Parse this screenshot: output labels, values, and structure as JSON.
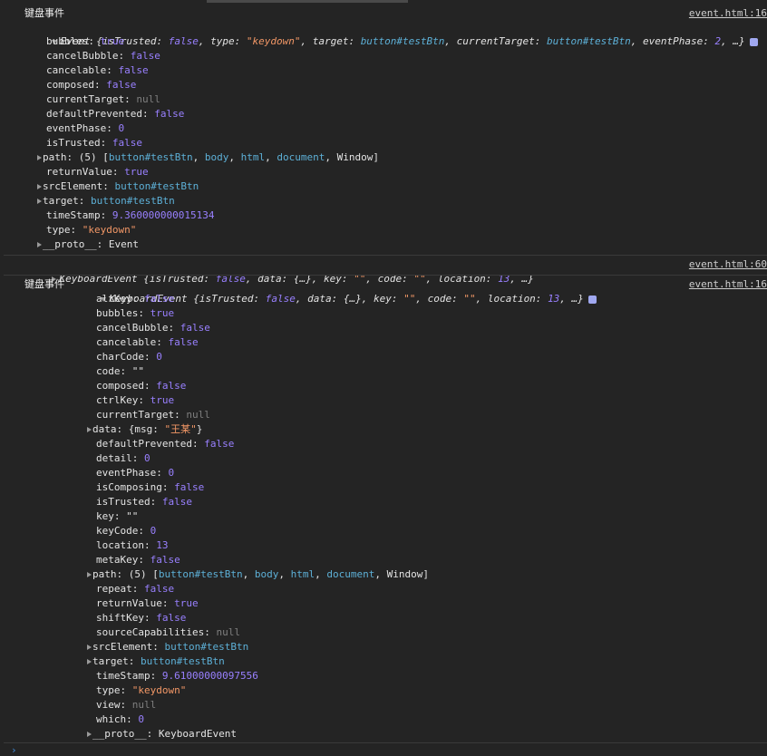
{
  "top": {
    "label": "键盘事件",
    "source": "event.html:16",
    "summary": {
      "lead": "Event {",
      "items": [
        {
          "k": "isTrusted",
          "v": "false",
          "t": "bool"
        },
        {
          "k": "type",
          "v": "\"keydown\"",
          "t": "str"
        },
        {
          "k": "target",
          "v": "button#testBtn",
          "t": "ref"
        },
        {
          "k": "currentTarget",
          "v": "button#testBtn",
          "t": "ref"
        },
        {
          "k": "eventPhase",
          "v": "2",
          "t": "num"
        }
      ],
      "tail": ", …}"
    },
    "props": [
      {
        "k": "bubbles",
        "v": "true",
        "t": "bool"
      },
      {
        "k": "cancelBubble",
        "v": "false",
        "t": "bool"
      },
      {
        "k": "cancelable",
        "v": "false",
        "t": "bool"
      },
      {
        "k": "composed",
        "v": "false",
        "t": "bool"
      },
      {
        "k": "currentTarget",
        "v": "null",
        "t": "null"
      },
      {
        "k": "defaultPrevented",
        "v": "false",
        "t": "bool"
      },
      {
        "k": "eventPhase",
        "v": "0",
        "t": "num"
      },
      {
        "k": "isTrusted",
        "v": "false",
        "t": "bool"
      },
      {
        "k": "path",
        "v": "(5) [button#testBtn, body, html, document, Window]",
        "t": "plain",
        "exp": true
      },
      {
        "k": "returnValue",
        "v": "true",
        "t": "bool"
      },
      {
        "k": "srcElement",
        "v": "button#testBtn",
        "t": "ref",
        "exp": true
      },
      {
        "k": "target",
        "v": "button#testBtn",
        "t": "ref",
        "exp": true
      },
      {
        "k": "timeStamp",
        "v": "9.360000000015134",
        "t": "num"
      },
      {
        "k": "type",
        "v": "\"keydown\"",
        "t": "str"
      },
      {
        "k": "__proto__",
        "v": "Event",
        "t": "plain",
        "exp": true
      }
    ]
  },
  "middle": {
    "source": "event.html:60",
    "summary": {
      "lead": "KeyboardEvent {",
      "items": [
        {
          "k": "isTrusted",
          "v": "false",
          "t": "bool"
        },
        {
          "k": "data",
          "v": "{…}",
          "t": "plain"
        },
        {
          "k": "key",
          "v": "\"\"",
          "t": "str"
        },
        {
          "k": "code",
          "v": "\"\"",
          "t": "str"
        },
        {
          "k": "location",
          "v": "13",
          "t": "num"
        }
      ],
      "tail": ", …}"
    }
  },
  "bottom": {
    "label": "键盘事件",
    "source": "event.html:16",
    "summary": {
      "lead": "KeyboardEvent {",
      "items": [
        {
          "k": "isTrusted",
          "v": "false",
          "t": "bool"
        },
        {
          "k": "data",
          "v": "{…}",
          "t": "plain"
        },
        {
          "k": "key",
          "v": "\"\"",
          "t": "str"
        },
        {
          "k": "code",
          "v": "\"\"",
          "t": "str"
        },
        {
          "k": "location",
          "v": "13",
          "t": "num"
        }
      ],
      "tail": ", …}"
    },
    "props": [
      {
        "k": "altKey",
        "v": "false",
        "t": "bool"
      },
      {
        "k": "bubbles",
        "v": "true",
        "t": "bool"
      },
      {
        "k": "cancelBubble",
        "v": "false",
        "t": "bool"
      },
      {
        "k": "cancelable",
        "v": "false",
        "t": "bool"
      },
      {
        "k": "charCode",
        "v": "0",
        "t": "num"
      },
      {
        "k": "code",
        "v": "\"\"",
        "t": "plain"
      },
      {
        "k": "composed",
        "v": "false",
        "t": "bool"
      },
      {
        "k": "ctrlKey",
        "v": "true",
        "t": "bool"
      },
      {
        "k": "currentTarget",
        "v": "null",
        "t": "null"
      },
      {
        "k": "data",
        "v": "{msg: \"王某\"}",
        "t": "data",
        "exp": true
      },
      {
        "k": "defaultPrevented",
        "v": "false",
        "t": "bool"
      },
      {
        "k": "detail",
        "v": "0",
        "t": "num"
      },
      {
        "k": "eventPhase",
        "v": "0",
        "t": "num"
      },
      {
        "k": "isComposing",
        "v": "false",
        "t": "bool"
      },
      {
        "k": "isTrusted",
        "v": "false",
        "t": "bool"
      },
      {
        "k": "key",
        "v": "\"\"",
        "t": "plain"
      },
      {
        "k": "keyCode",
        "v": "0",
        "t": "num"
      },
      {
        "k": "location",
        "v": "13",
        "t": "num"
      },
      {
        "k": "metaKey",
        "v": "false",
        "t": "bool"
      },
      {
        "k": "path",
        "v": "(5) [button#testBtn, body, html, document, Window]",
        "t": "plain",
        "exp": true
      },
      {
        "k": "repeat",
        "v": "false",
        "t": "bool"
      },
      {
        "k": "returnValue",
        "v": "true",
        "t": "bool"
      },
      {
        "k": "shiftKey",
        "v": "false",
        "t": "bool"
      },
      {
        "k": "sourceCapabilities",
        "v": "null",
        "t": "null"
      },
      {
        "k": "srcElement",
        "v": "button#testBtn",
        "t": "ref",
        "exp": true
      },
      {
        "k": "target",
        "v": "button#testBtn",
        "t": "ref",
        "exp": true
      },
      {
        "k": "timeStamp",
        "v": "9.61000000097556",
        "t": "num"
      },
      {
        "k": "type",
        "v": "\"keydown\"",
        "t": "str"
      },
      {
        "k": "view",
        "v": "null",
        "t": "null"
      },
      {
        "k": "which",
        "v": "0",
        "t": "num"
      },
      {
        "k": "__proto__",
        "v": "KeyboardEvent",
        "t": "plain",
        "exp": true
      }
    ]
  },
  "prompt": "›"
}
